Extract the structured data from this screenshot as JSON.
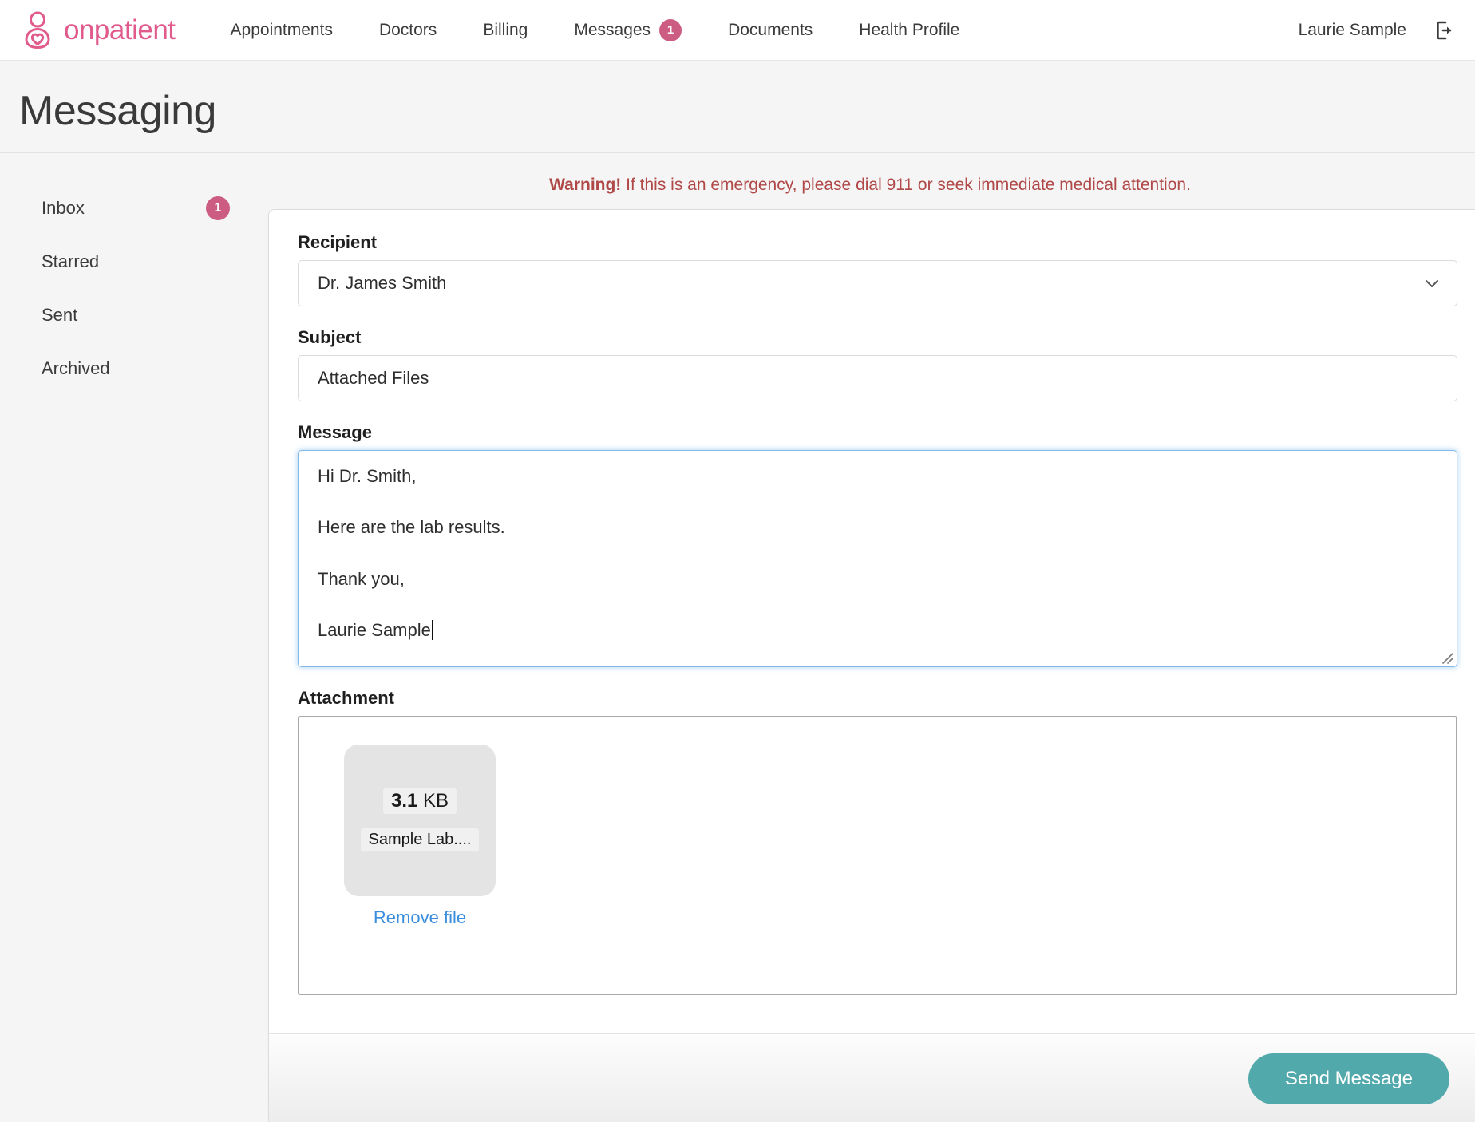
{
  "brand": {
    "name": "onpatient",
    "logo_icon": "onpatient-person-heart-logo",
    "color": "#e05b8c"
  },
  "nav": {
    "items": [
      {
        "label": "Appointments",
        "badge": null
      },
      {
        "label": "Doctors",
        "badge": null
      },
      {
        "label": "Billing",
        "badge": null
      },
      {
        "label": "Messages",
        "badge": "1"
      },
      {
        "label": "Documents",
        "badge": null
      },
      {
        "label": "Health Profile",
        "badge": null
      }
    ],
    "user_name": "Laurie Sample",
    "signout_icon": "sign-out-icon"
  },
  "page": {
    "title": "Messaging"
  },
  "sidebar": {
    "items": [
      {
        "label": "Inbox",
        "badge": "1"
      },
      {
        "label": "Starred",
        "badge": null
      },
      {
        "label": "Sent",
        "badge": null
      },
      {
        "label": "Archived",
        "badge": null
      }
    ]
  },
  "warning": {
    "strong": "Warning!",
    "text": " If this is an emergency, please dial 911 or seek immediate medical attention.",
    "color": "#b04848"
  },
  "form": {
    "recipient": {
      "label": "Recipient",
      "value": "Dr. James Smith",
      "options": [
        "Dr. James Smith"
      ],
      "chevron_icon": "chevron-down-icon"
    },
    "subject": {
      "label": "Subject",
      "value": "Attached Files",
      "placeholder": "Subject"
    },
    "message": {
      "label": "Message",
      "placeholder": "Message",
      "lines": [
        "Hi Dr. Smith,",
        "Here are the lab results.",
        "Thank you,",
        "Laurie Sample"
      ],
      "focused": true
    },
    "attachment": {
      "label": "Attachment",
      "file": {
        "size_value": "3.1",
        "size_unit": " KB",
        "name": "Sample Lab....",
        "remove_label": "Remove file"
      }
    },
    "submit_label": "Send Message",
    "submit_color": "#52a9ab"
  }
}
